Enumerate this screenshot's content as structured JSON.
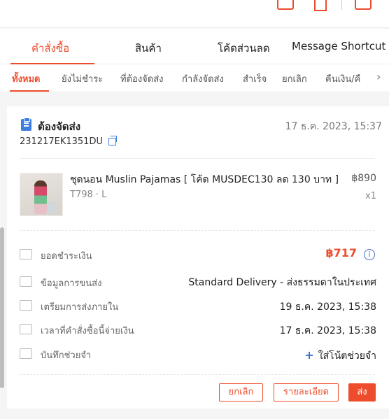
{
  "tabs": [
    "คำสั่งซื้อ",
    "สินค้า",
    "โค้ดส่วนลด",
    "Message Shortcut"
  ],
  "subtabs": [
    "ทั้งหมด",
    "ยังไม่ชำระ",
    "ที่ต้องจัดส่ง",
    "กำลังจัดส่ง",
    "สำเร็จ",
    "ยกเลิก",
    "คืนเงิน/คื"
  ],
  "order": {
    "status": "ต้องจัดส่ง",
    "date": "17 ธ.ค. 2023, 15:37",
    "sn": "231217EK1351DU",
    "product": {
      "name": "ชุดนอน Muslin Pajamas [ โค้ด MUSDEC130 ลด 130 บาท ]",
      "variation": "T798 · L",
      "price": "฿890",
      "qty": "x1"
    },
    "payment_label": "ยอดชำระเงิน",
    "payment_amount": "฿717",
    "shipping_label": "ข้อมูลการขนส่ง",
    "shipping_value": "Standard Delivery - ส่งธรรมดาในประเทศ",
    "prepare_label": "เตรียมการส่งภายใน",
    "prepare_value": "19 ธ.ค. 2023, 15:38",
    "paid_label": "เวลาที่คำสั่งซื้อนี้จ่ายเงิน",
    "paid_value": "17 ธ.ค. 2023, 15:38",
    "note_label": "บันทึกช่วยจำ",
    "note_link": "ใส่โน้ตช่วยจำ"
  },
  "actions": {
    "cancel": "ยกเลิก",
    "details": "รายละเอียด",
    "ship": "ส่ง"
  },
  "colors": {
    "accent": "#ee4d2d",
    "link": "#3d7de0"
  },
  "icons": [
    "clipboard-icon",
    "copy-icon",
    "wallet-icon",
    "truck-icon",
    "calendar-icon",
    "clock-icon",
    "note-icon",
    "info-icon",
    "chevron-right-icon"
  ]
}
